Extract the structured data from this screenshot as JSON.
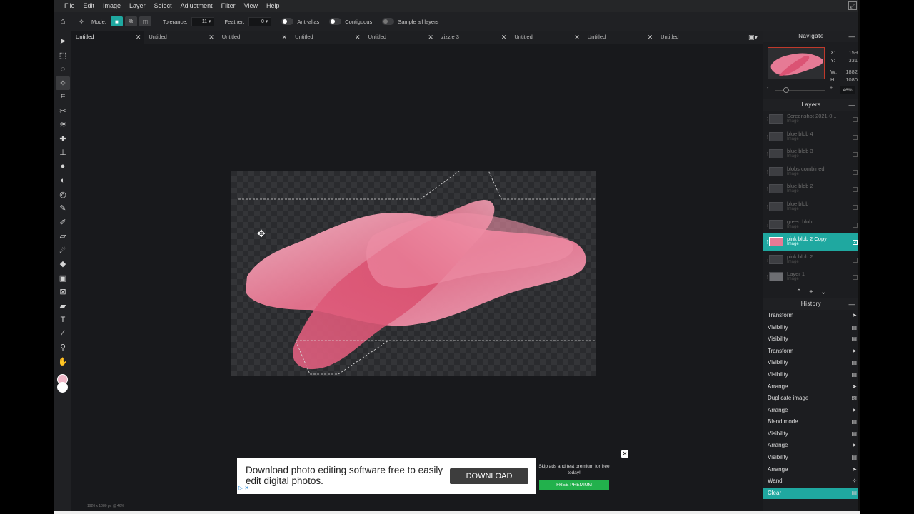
{
  "menu": [
    "File",
    "Edit",
    "Image",
    "Layer",
    "Select",
    "Adjustment",
    "Filter",
    "View",
    "Help"
  ],
  "options": {
    "mode_label": "Mode:",
    "tolerance_label": "Tolerance:",
    "tolerance_value": "11 ▾",
    "feather_label": "Feather:",
    "feather_value": "0 ▾",
    "antialias_label": "Anti-alias",
    "contiguous_label": "Contiguous",
    "sample_label": "Sample all layers"
  },
  "tabs": [
    "Untitled",
    "Untitled",
    "Untitled",
    "Untitled",
    "Untitled",
    "zizzie 3",
    "Untitled",
    "Untitled",
    "Untitled"
  ],
  "canvas": {
    "doc_info": "1920 x 1080 px @ 46%"
  },
  "ad": {
    "text": "Download photo editing software free to easily edit digital photos.",
    "button": "DOWNLOAD",
    "side_text": "Skip ads and test premium for free today!",
    "premium_button": "FREE PREMIUM",
    "close": "✕",
    "adchoice": "▷ ✕"
  },
  "navigate": {
    "title": "Navigate",
    "x_label": "X:",
    "x": "159",
    "y_label": "Y:",
    "y": "331",
    "w_label": "W:",
    "w": "1882",
    "h_label": "H:",
    "h": "1080",
    "zoom": "46%"
  },
  "layers": {
    "title": "Layers",
    "items": [
      {
        "name": "Screenshot 2021-0...",
        "type": "Image"
      },
      {
        "name": "blue blob 4",
        "type": "Image"
      },
      {
        "name": "blue blob 3",
        "type": "Image"
      },
      {
        "name": "blobs combined",
        "type": "Image"
      },
      {
        "name": "blue blob 2",
        "type": "Image"
      },
      {
        "name": "blue blob",
        "type": "Image"
      },
      {
        "name": "green blob",
        "type": "Image"
      },
      {
        "name": "pink blob 2 Copy",
        "type": "Image"
      },
      {
        "name": "pink blob 2",
        "type": "Image"
      },
      {
        "name": "Layer 1",
        "type": "Image"
      }
    ],
    "active_index": 7
  },
  "history": {
    "title": "History",
    "items": [
      "Transform",
      "Visibility",
      "Visibility",
      "Transform",
      "Visibility",
      "Visibility",
      "Arrange",
      "Duplicate image",
      "Arrange",
      "Blend mode",
      "Visibility",
      "Arrange",
      "Visibility",
      "Arrange",
      "Wand",
      "Clear"
    ]
  },
  "colors": {
    "accent": "#1fa8a0",
    "foreground": "#f0b8c8",
    "background": "#ffffff",
    "premium": "#22b14c"
  }
}
